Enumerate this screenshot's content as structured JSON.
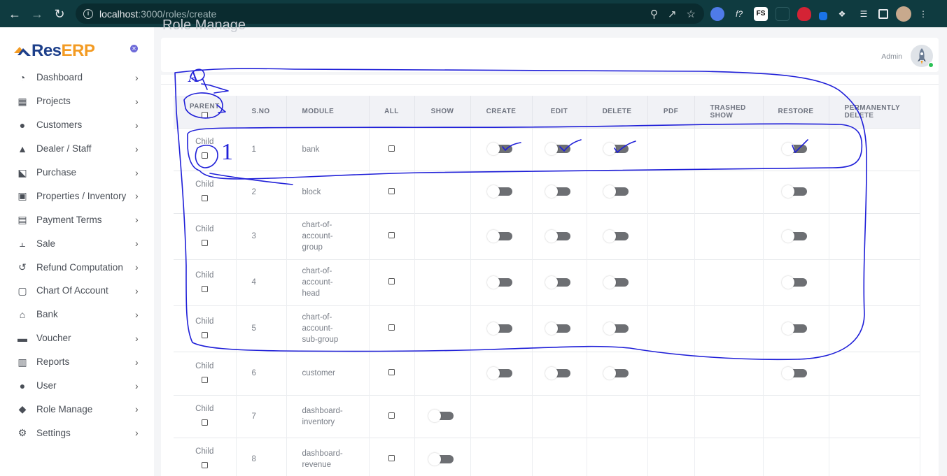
{
  "browser": {
    "url_host": "localhost",
    "url_rest": ":3000/roles/create"
  },
  "sidebar": {
    "logo_res": "Res",
    "logo_erp": "ERP",
    "items": [
      {
        "label": "Dashboard",
        "icon": "gauge-icon"
      },
      {
        "label": "Projects",
        "icon": "building-icon"
      },
      {
        "label": "Customers",
        "icon": "user-icon"
      },
      {
        "label": "Dealer / Staff",
        "icon": "graduation-cap-icon"
      },
      {
        "label": "Purchase",
        "icon": "cart-icon"
      },
      {
        "label": "Properties / Inventory",
        "icon": "warehouse-icon"
      },
      {
        "label": "Payment Terms",
        "icon": "board-icon"
      },
      {
        "label": "Sale",
        "icon": "dolly-icon"
      },
      {
        "label": "Refund Computation",
        "icon": "undo-icon"
      },
      {
        "label": "Chart Of Account",
        "icon": "invoice-dollar-icon"
      },
      {
        "label": "Bank",
        "icon": "bank-icon"
      },
      {
        "label": "Voucher",
        "icon": "wallet-icon"
      },
      {
        "label": "Reports",
        "icon": "report-icon"
      },
      {
        "label": "User",
        "icon": "user-icon"
      },
      {
        "label": "Role Manage",
        "icon": "user-shield-icon"
      },
      {
        "label": "Settings",
        "icon": "gears-icon"
      }
    ]
  },
  "main": {
    "ghost_title": "Role Manage",
    "admin_label": "Admin"
  },
  "table": {
    "headers": {
      "parent": "PARENT",
      "sno": "S.NO",
      "module": "MODULE",
      "all": "ALL",
      "show": "SHOW",
      "create": "CREATE",
      "edit": "EDIT",
      "delete": "DELETE",
      "pdf": "PDF",
      "trashed_show_1": "TRASHED",
      "trashed_show_2": "SHOW",
      "restore": "RESTORE",
      "perm_delete_1": "PERMANENTLY",
      "perm_delete_2": "DELETE"
    },
    "child_label": "Child",
    "rows": [
      {
        "sno": "1",
        "module": [
          "bank"
        ]
      },
      {
        "sno": "2",
        "module": [
          "block"
        ]
      },
      {
        "sno": "3",
        "module": [
          "chart-of-",
          "account-",
          "group"
        ]
      },
      {
        "sno": "4",
        "module": [
          "chart-of-",
          "account-",
          "head"
        ]
      },
      {
        "sno": "5",
        "module": [
          "chart-of-",
          "account-",
          "sub-group"
        ]
      },
      {
        "sno": "6",
        "module": [
          "customer"
        ]
      },
      {
        "sno": "7",
        "module": [
          "dashboard-",
          "inventory"
        ]
      },
      {
        "sno": "8",
        "module": [
          "dashboard-",
          "revenue"
        ]
      }
    ]
  },
  "annotation": {
    "label_a": "A",
    "label_1": "1",
    "color": "#1f1fd8"
  }
}
